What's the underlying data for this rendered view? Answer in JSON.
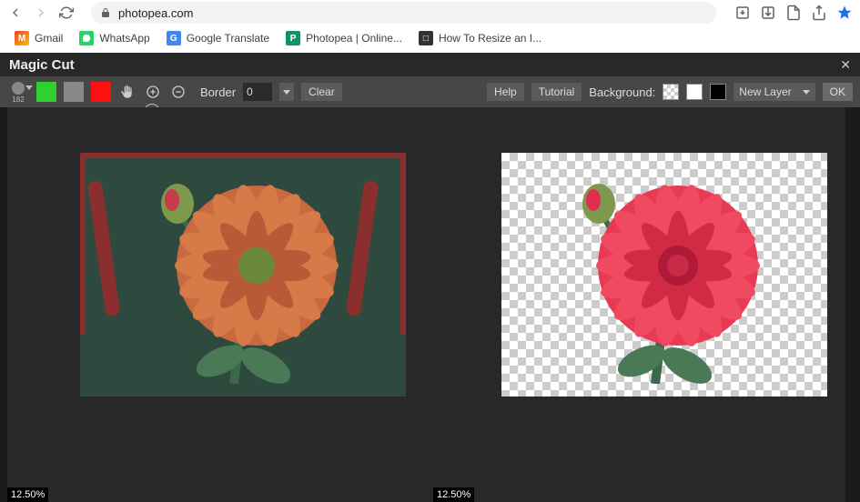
{
  "browser": {
    "url": "photopea.com",
    "bookmarks": [
      {
        "label": "Gmail",
        "fv": "M"
      },
      {
        "label": "WhatsApp",
        "fv": ""
      },
      {
        "label": "Google Translate",
        "fv": "G"
      },
      {
        "label": "Photopea | Online...",
        "fv": "P"
      },
      {
        "label": "How To Resize an I...",
        "fv": "□"
      }
    ]
  },
  "app_title": "Magic Cut",
  "brush_size": "182",
  "border_label": "Border",
  "border_value": "0",
  "clear_label": "Clear",
  "help_label": "Help",
  "tutorial_label": "Tutorial",
  "background_label": "Background:",
  "layer_mode": "New Layer",
  "ok_label": "OK",
  "zoom_left": "12.50%",
  "zoom_right": "12.50%"
}
